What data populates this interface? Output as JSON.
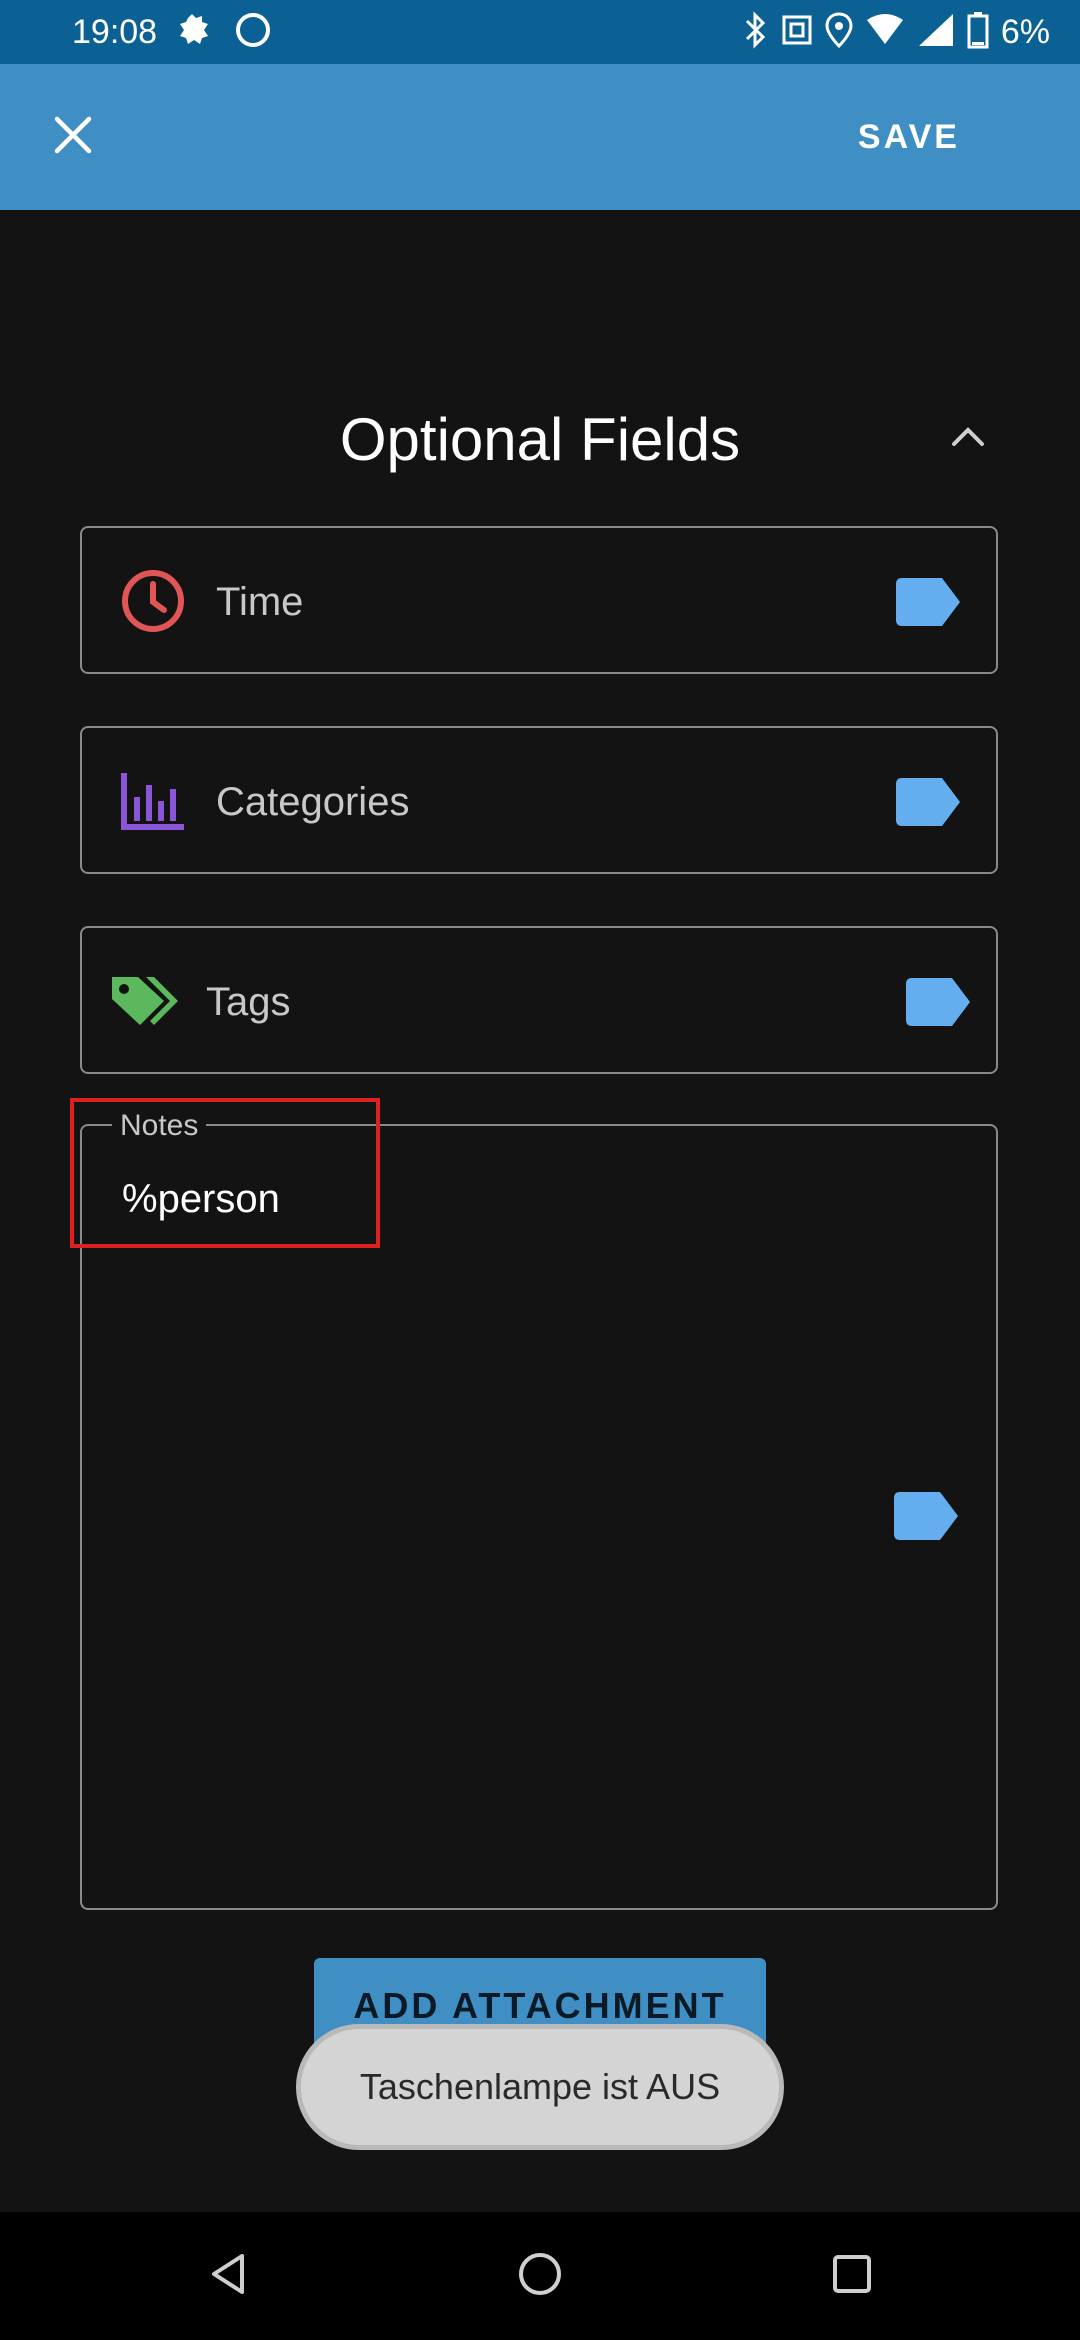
{
  "status_bar": {
    "time": "19:08",
    "battery_text": "6%",
    "icons": [
      "weather-icon",
      "circle-icon",
      "bluetooth-icon",
      "nfc-icon",
      "location-icon",
      "wifi-icon",
      "signal-icon",
      "battery-icon"
    ]
  },
  "app_bar": {
    "close_icon": "close-icon",
    "save_label": "SAVE",
    "color": "#3f8fc4"
  },
  "section": {
    "title": "Optional Fields",
    "toggle_icon": "chevron-up-icon"
  },
  "fields": [
    {
      "label": "Time",
      "icon": "clock-icon",
      "icon_color": "#e05555"
    },
    {
      "label": "Categories",
      "icon": "bar-chart-icon",
      "icon_color": "#8a55d6"
    },
    {
      "label": "Tags",
      "icon": "tags-icon",
      "icon_color": "#5cb85c"
    }
  ],
  "notes": {
    "label": "Notes",
    "value": "%person"
  },
  "attachment": {
    "label": "ADD ATTACHMENT"
  },
  "toast": {
    "text": "Taschenlampe ist AUS"
  },
  "nav": [
    "back-icon",
    "home-icon",
    "recents-icon"
  ],
  "colors": {
    "tag": "#64aef0",
    "highlight": "#e02020"
  }
}
